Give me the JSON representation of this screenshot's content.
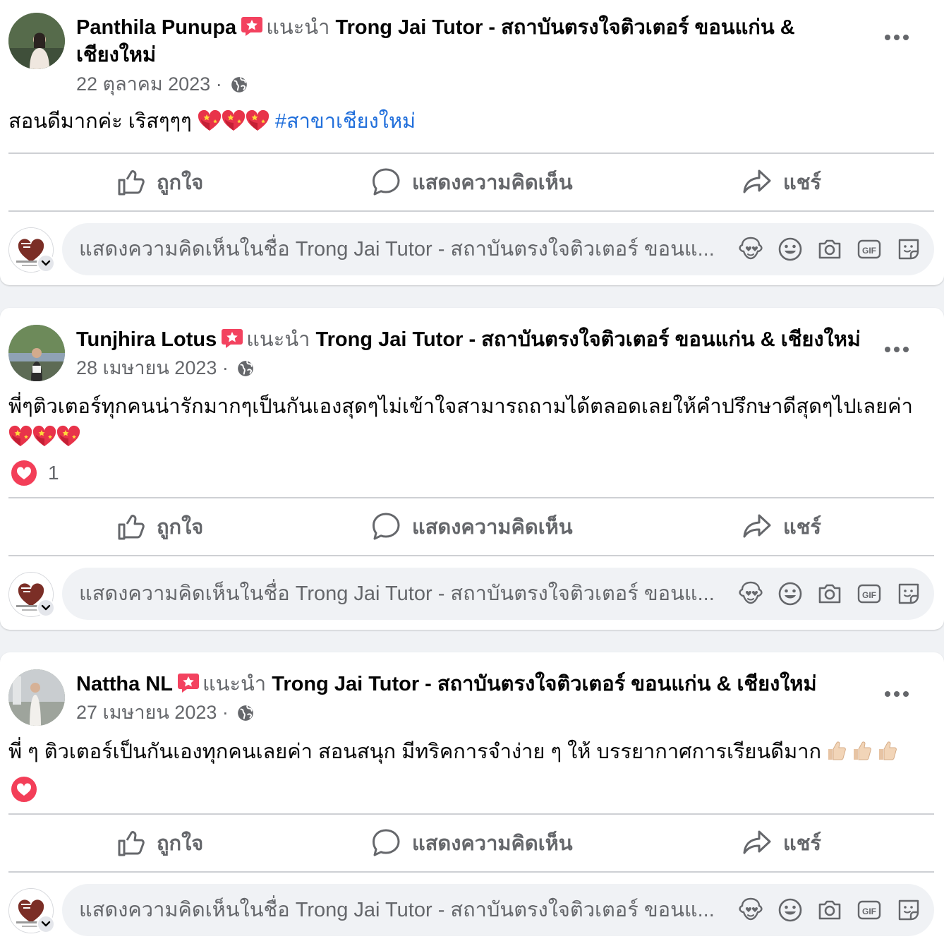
{
  "recommend_word": "แนะนำ",
  "page_name": "Trong Jai Tutor - สถาบันตรงใจติวเตอร์ ขอนแก่น & เชียงใหม่",
  "actions": {
    "like": "ถูกใจ",
    "comment": "แสดงความคิดเห็น",
    "share": "แชร์"
  },
  "composer": {
    "placeholder": "แสดงความคิดเห็นในชื่อ Trong Jai Tutor - สถาบันตรงใจติวเตอร์ ขอนแ...",
    "icons": [
      "avatar-sticker-icon",
      "emoji-icon",
      "camera-icon",
      "gif-icon",
      "sticker-icon"
    ]
  },
  "posts": [
    {
      "author": "Panthila Punupa",
      "page_line1": "Trong Jai Tutor - สถาบันตรงใจติวเตอร์ ขอนแก่น &",
      "page_line2": "เชียงใหม่",
      "date": "22 ตุลาคม 2023",
      "text": "สอนดีมากค่ะ เริสๆๆๆ",
      "hashtag": "#สาขาเชียงใหม่",
      "reaction_count": ""
    },
    {
      "author": "Tunjhira Lotus",
      "date": "28 เมษายน 2023",
      "text": "พี่ๆติวเตอร์ทุกคนน่ารักมากๆเป็นกันเองสุดๆไม่เข้าใจสามารถถามได้ตลอดเลยให้คำปรึกษาดีสุดๆไปเลยค่า",
      "reaction_count": "1"
    },
    {
      "author": "Nattha NL",
      "date": "27 เมษายน 2023",
      "text": "พี่ ๆ ติวเตอร์เป็นกันเองทุกคนเลยค่า สอนสนุก มีทริคการจำง่าย ๆ ให้ บรรยากาศการเรียนดีมาก",
      "reaction_count": ""
    }
  ],
  "colors": {
    "accent_link": "#216fdb",
    "secondary_text": "#65676b",
    "heart": "#f33e58"
  }
}
